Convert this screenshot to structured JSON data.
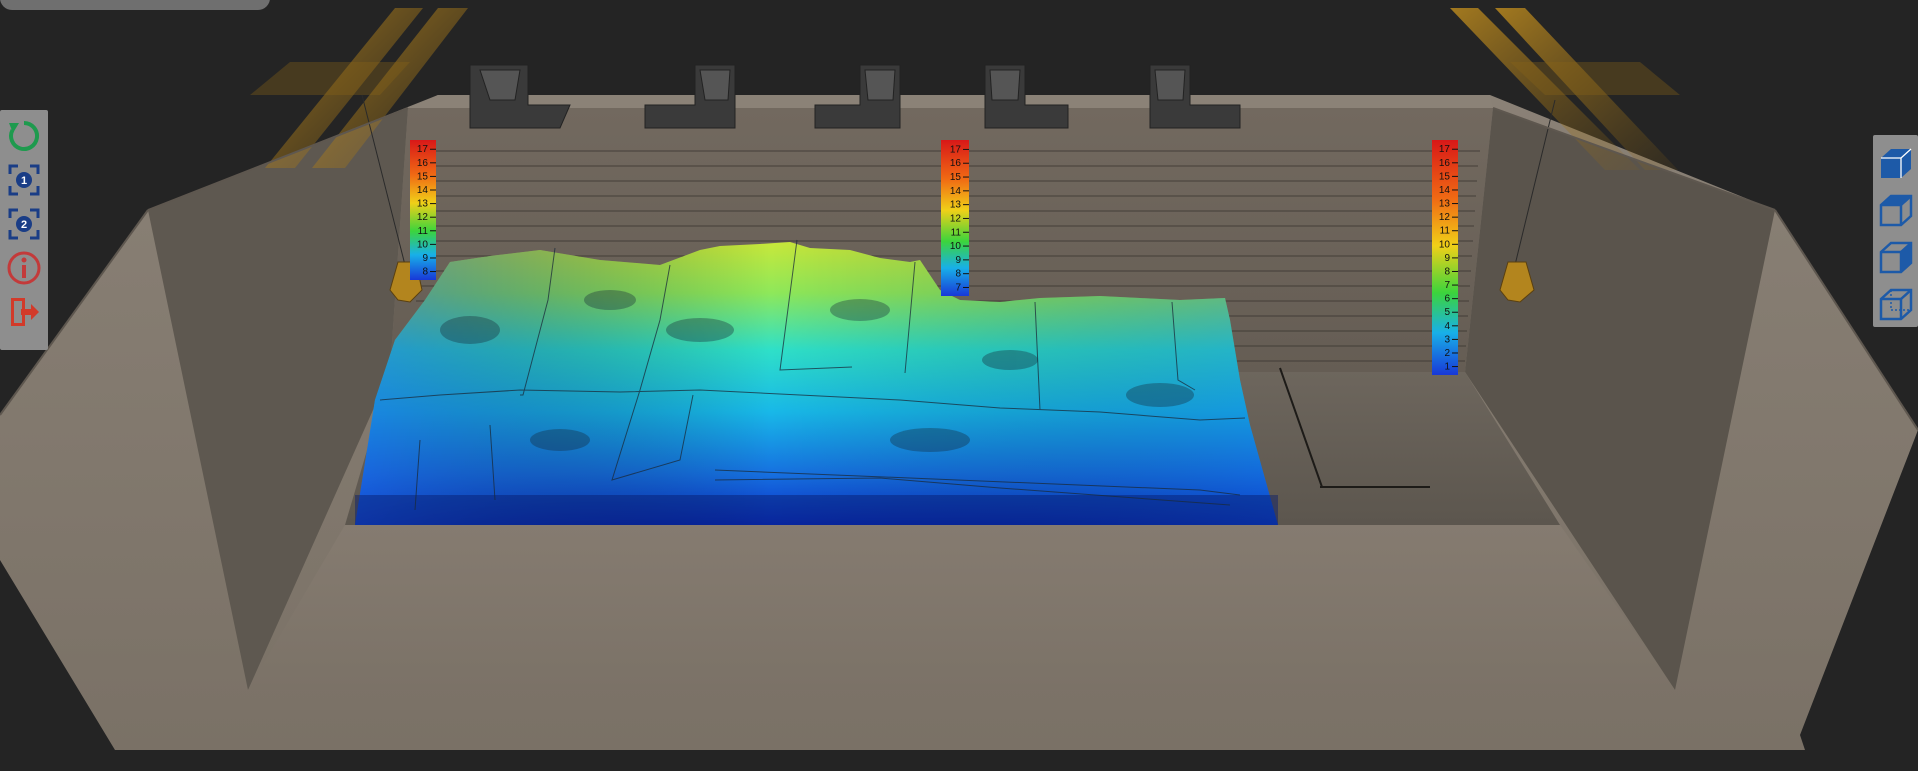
{
  "colors": {
    "background": "#242424",
    "concrete": "#7e756b",
    "toolbar": "#8e8e8e",
    "reset_green": "#1e9a4e",
    "view_blue": "#1a3d86",
    "info_red": "#c33a3a",
    "exit_red": "#d23a2a",
    "cube_blue": "#1d5aa8"
  },
  "icons": {
    "reset": "reset-view-icon",
    "view1": "view-1-icon",
    "view2": "view-2-icon",
    "info": "info-icon",
    "exit": "exit-icon",
    "cube_views": [
      "cube-view-front-icon",
      "cube-view-side-icon",
      "cube-view-top-icon",
      "cube-view-iso-icon"
    ]
  },
  "view_buttons": {
    "view1": "1",
    "view2": "2"
  },
  "scales": {
    "left": [
      "17",
      "16",
      "15",
      "14",
      "13",
      "12",
      "11",
      "10",
      "9",
      "8"
    ],
    "center": [
      "17",
      "16",
      "15",
      "14",
      "13",
      "12",
      "11",
      "10",
      "9",
      "8",
      "7"
    ],
    "right": [
      "17",
      "16",
      "15",
      "14",
      "13",
      "12",
      "11",
      "10",
      "9",
      "8",
      "7",
      "6",
      "5",
      "4",
      "3",
      "2",
      "1"
    ]
  }
}
